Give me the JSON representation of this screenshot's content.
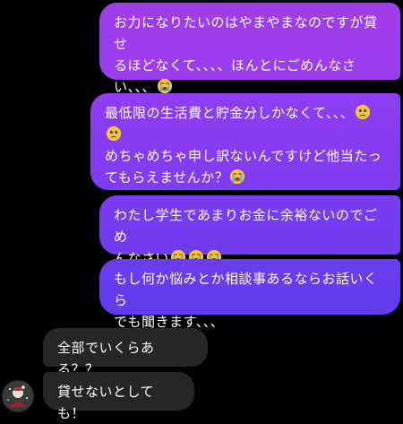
{
  "chat": {
    "messages": [
      {
        "id": "b1",
        "direction": "outgoing",
        "lines": [
          "お力になりたいのはやまやまなのですが貸せ",
          "るほどなくて、、、、ほんとにごめんなさ",
          "い、、、"
        ],
        "trailing_emoji": [
          "loudly-crying-face"
        ]
      },
      {
        "id": "b2",
        "direction": "outgoing",
        "lines": [
          "最低限の生活費と貯金分しかなくて、、、",
          "",
          "めちゃめちゃ申し訳ないんですけど他当たっ",
          "てもらえませんか？"
        ],
        "emoji": [
          "face-holding-back-tears",
          "face-holding-back-tears",
          "loudly-crying-face"
        ]
      },
      {
        "id": "b3",
        "direction": "outgoing",
        "lines": [
          "わたし学生であまりお金に余裕ないのでごめ",
          "んなさい"
        ],
        "trailing_emoji": [
          "loudly-crying-face",
          "loudly-crying-face",
          "loudly-crying-face"
        ]
      },
      {
        "id": "b4",
        "direction": "outgoing",
        "lines": [
          "もし何か悩みとか相談事あるならお話いくら",
          "でも聞きます、、、"
        ]
      },
      {
        "id": "b5",
        "direction": "incoming",
        "text": "全部でいくらある？？"
      },
      {
        "id": "b6",
        "direction": "incoming",
        "text": "貸せないとしても！"
      }
    ]
  },
  "colors": {
    "background": "#000000",
    "incoming_bubble": "#262626",
    "outgoing_top": "#a03ee8",
    "outgoing_bottom": "#603ced",
    "emoji_face": "#f7c531"
  },
  "avatar": {
    "icon": "avatar-icon"
  }
}
